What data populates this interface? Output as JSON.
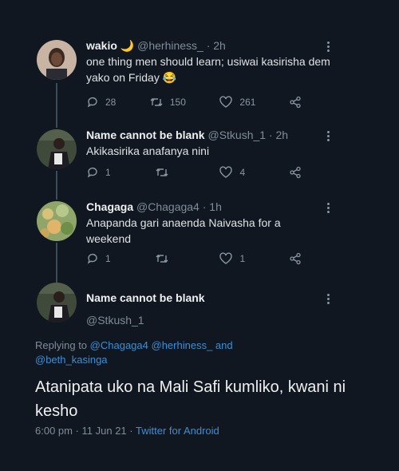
{
  "thread": [
    {
      "name": "wakio",
      "emoji": "🌙",
      "handle": "@herhiness_",
      "time": "· 2h",
      "text": "one thing men should learn; usiwai kasirisha dem yako on Friday 😂",
      "reply_count": "28",
      "retweet_count": "150",
      "like_count": "261"
    },
    {
      "name": "Name cannot be blank",
      "handle": "@Stkush_1",
      "time": "· 2h",
      "text": "Akikasirika anafanya nini",
      "reply_count": "1",
      "retweet_count": "",
      "like_count": "4"
    },
    {
      "name": "Chagaga",
      "handle": "@Chagaga4",
      "time": "· 1h",
      "text": "Anapanda gari anaenda Naivasha for a weekend",
      "reply_count": "1",
      "retweet_count": "",
      "like_count": "1"
    }
  ],
  "main_tweet": {
    "name": "Name cannot be blank",
    "handle": "@Stkush_1",
    "replying_prefix": "Replying to",
    "replying_1": "@Chagaga4",
    "replying_2": "@herhiness_",
    "replying_and": "and",
    "replying_3": "@beth_kasinga",
    "text": "Atanipata uko na Mali Safi kumliko, kwani ni kesho",
    "timestamp": "6:00 pm · 11 Jun 21 ·",
    "source": "Twitter for Android"
  },
  "colors": {
    "background": "#101720",
    "link": "#3b8fd6",
    "muted": "#7f8c99"
  }
}
